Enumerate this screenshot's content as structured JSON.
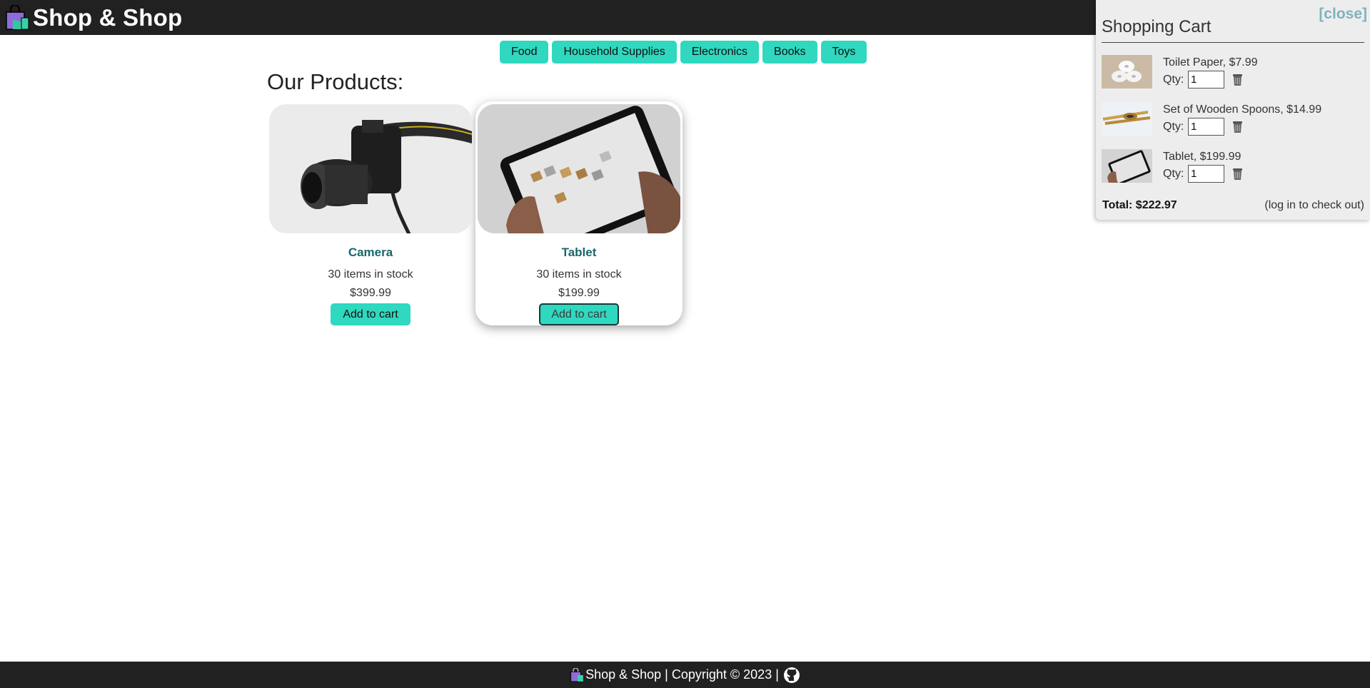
{
  "header": {
    "brand": "Shop & Shop",
    "logo_icon": "shopping-bag-icon"
  },
  "nav": {
    "categories": [
      "Food",
      "Household Supplies",
      "Electronics",
      "Books",
      "Toys"
    ]
  },
  "main": {
    "section_title": "Our Products:",
    "products": [
      {
        "name": "Camera",
        "stock": "30 items in stock",
        "price": "$399.99",
        "button": "Add to cart",
        "image_icon": "camera-image"
      },
      {
        "name": "Tablet",
        "stock": "30 items in stock",
        "price": "$199.99",
        "button": "Add to cart",
        "image_icon": "tablet-image"
      }
    ]
  },
  "cart": {
    "close_label": "[close]",
    "title": "Shopping Cart",
    "qty_label": "Qty:",
    "items": [
      {
        "title": "Toilet Paper, $7.99",
        "qty": "1",
        "thumb": "toilet-paper-image"
      },
      {
        "title": "Set of Wooden Spoons, $14.99",
        "qty": "1",
        "thumb": "wooden-spoons-image"
      },
      {
        "title": "Tablet, $199.99",
        "qty": "1",
        "thumb": "tablet-image"
      }
    ],
    "total": "Total: $222.97",
    "checkout_note": "(log in to check out)"
  },
  "footer": {
    "text": "Shop & Shop | Copyright © 2023 |",
    "icon": "github-icon"
  },
  "colors": {
    "accent": "#2fd8bf",
    "header_bg": "#212121",
    "product_name": "#18676b",
    "close_link": "#7fb3bf"
  }
}
